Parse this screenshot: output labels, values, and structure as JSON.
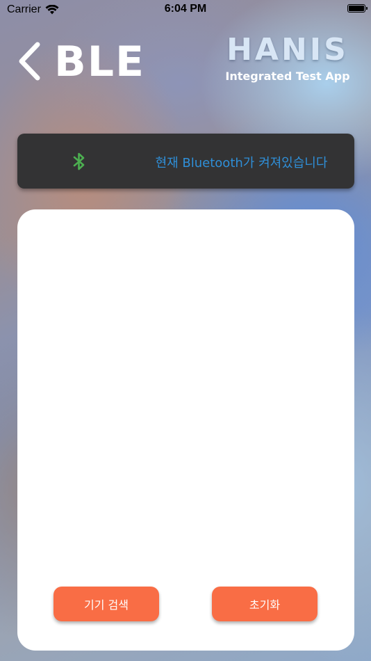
{
  "status_bar": {
    "carrier": "Carrier",
    "time": "6:04 PM",
    "wifi_icon": "wifi-icon",
    "battery_icon": "battery-icon"
  },
  "header": {
    "title": "BLE",
    "back_icon": "chevron-left-icon",
    "brand_logo": "HANIS",
    "brand_subtitle": "Integrated Test App"
  },
  "bluetooth_status": {
    "icon": "bluetooth-icon",
    "icon_color": "#4caf50",
    "message": "현재 Bluetooth가 켜져있습니다",
    "message_color": "#2f8fd8"
  },
  "device_panel": {
    "devices": [],
    "scan_button_label": "기기 검색",
    "reset_button_label": "초기화",
    "button_color": "#f96d45"
  }
}
